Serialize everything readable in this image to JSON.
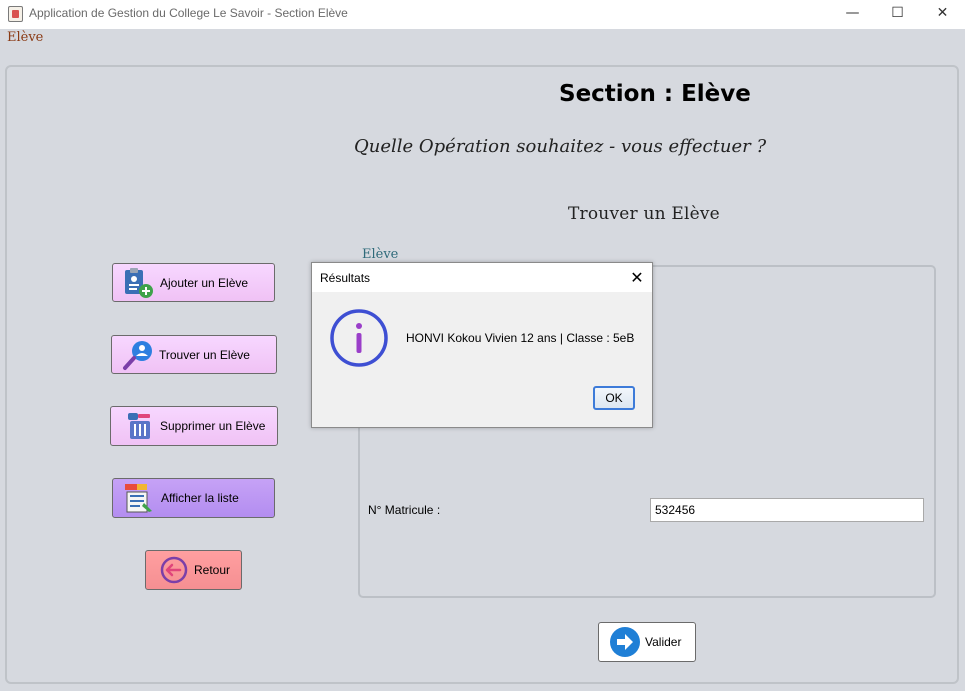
{
  "window": {
    "title": "Application de Gestion du College Le Savoir - Section Elève",
    "minimize_glyph": "—",
    "maximize_glyph": "☐",
    "close_glyph": "✕"
  },
  "menu": {
    "eleve": "Elève"
  },
  "header": {
    "section_title": "Section  :  Elève",
    "question": "Quelle Opération souhaitez - vous effectuer ?",
    "form_title": "Trouver un Elève"
  },
  "sidebar": {
    "items": [
      {
        "label": "Ajouter un Elève",
        "icon": "add-student-icon"
      },
      {
        "label": "Trouver un Elève",
        "icon": "search-student-icon"
      },
      {
        "label": "Supprimer un Elève",
        "icon": "delete-student-icon"
      },
      {
        "label": "Afficher la liste",
        "icon": "list-icon"
      },
      {
        "label": "Retour",
        "icon": "back-arrow-icon"
      }
    ]
  },
  "form": {
    "group_caption": "Elève",
    "matricule_label": "N° Matricule :",
    "matricule_value": "532456",
    "submit_label": "Valider",
    "submit_icon": "arrow-right-icon"
  },
  "dialog": {
    "title": "Résultats",
    "close_glyph": "✕",
    "message": "HONVI Kokou Vivien 12 ans | Classe : 5eB",
    "icon": "info-icon",
    "ok_label": "OK"
  },
  "colors": {
    "pink_button": "#f0c2f5",
    "purple_button": "#b38df0",
    "red_button": "#f58f92",
    "info_blue": "#3e4fd3"
  }
}
